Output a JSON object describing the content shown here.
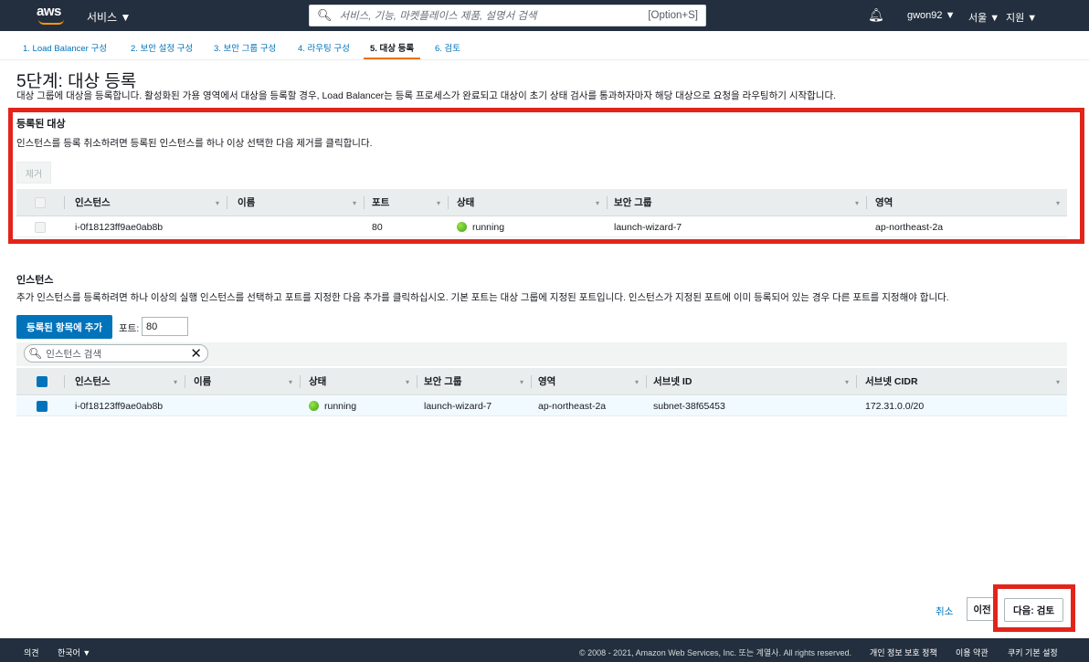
{
  "nav": {
    "logo": "aws",
    "services": "서비스 ▼",
    "search_placeholder": "서비스, 기능, 마켓플레이스 제품, 설명서 검색",
    "search_shortcut": "[Option+S]",
    "user": "gwon92 ▼",
    "region": "서울 ▼",
    "support": "지원 ▼"
  },
  "steps": [
    "1. Load Balancer 구성",
    "2. 보안 설정 구성",
    "3. 보안 그룹 구성",
    "4. 라우팅 구성",
    "5. 대상 등록",
    "6. 검토"
  ],
  "page": {
    "title": "5단계: 대상 등록",
    "description": "대상 그룹에 대상을 등록합니다. 활성화된 가용 영역에서 대상을 등록할 경우, Load Balancer는 등록 프로세스가 완료되고 대상이 초기 상태 검사를 통과하자마자 해당 대상으로 요청을 라우팅하기 시작합니다."
  },
  "registered": {
    "title": "등록된 대상",
    "description": "인스턴스를 등록 취소하려면 등록된 인스턴스를 하나 이상 선택한 다음 제거를 클릭합니다.",
    "remove_label": "제거",
    "columns": [
      "인스턴스",
      "이름",
      "포트",
      "상태",
      "보안 그룹",
      "영역"
    ],
    "rows": [
      {
        "instance": "i-0f18123ff9ae0ab8b",
        "name": "",
        "port": "80",
        "state": "running",
        "security_group": "launch-wizard-7",
        "zone": "ap-northeast-2a"
      }
    ]
  },
  "instances": {
    "title": "인스턴스",
    "description": "추가 인스턴스를 등록하려면 하나 이상의 실행 인스턴스를 선택하고 포트를 지정한 다음 추가를 클릭하십시오. 기본 포트는 대상 그룹에 지정된 포트입니다. 인스턴스가 지정된 포트에 이미 등록되어 있는 경우 다른 포트를 지정해야 합니다.",
    "add_label": "등록된 항목에 추가",
    "port_label": "포트:",
    "port_value": "80",
    "filter_placeholder": "인스턴스 검색",
    "columns": [
      "인스턴스",
      "이름",
      "상태",
      "보안 그룹",
      "영역",
      "서브넷 ID",
      "서브넷 CIDR"
    ],
    "rows": [
      {
        "instance": "i-0f18123ff9ae0ab8b",
        "name": "",
        "state": "running",
        "security_group": "launch-wizard-7",
        "zone": "ap-northeast-2a",
        "subnet_id": "subnet-38f65453",
        "subnet_cidr": "172.31.0.0/20",
        "selected": true
      }
    ]
  },
  "actions": {
    "cancel": "취소",
    "previous": "이전",
    "next": "다음: 검토"
  },
  "footer": {
    "feedback": "의견",
    "language": "한국어 ▼",
    "copyright": "© 2008 - 2021, Amazon Web Services, Inc. 또는 계열사. All rights reserved.",
    "privacy": "개인 정보 보호 정책",
    "terms": "이용 약관",
    "cookies": "쿠키 기본 설정"
  },
  "colors": {
    "nav_bg": "#232f3e",
    "accent": "#ec7211",
    "link": "#0073bb",
    "highlight_box": "#e2241b"
  }
}
